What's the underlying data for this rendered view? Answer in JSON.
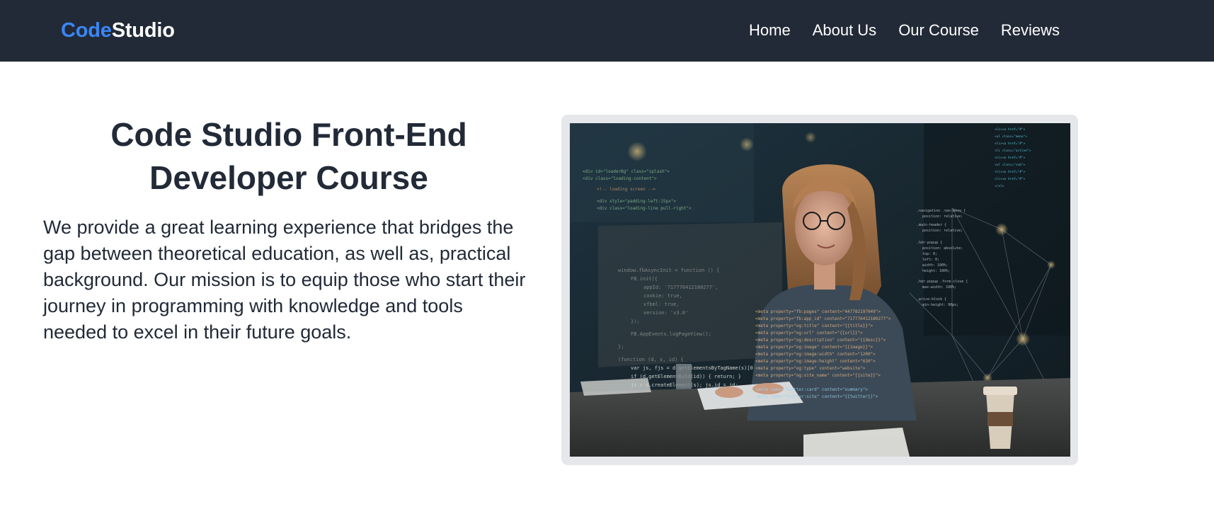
{
  "brand": {
    "part1": "Code",
    "part2": "Studio",
    "accent_color": "#3a86f5"
  },
  "nav": {
    "items": [
      {
        "label": "Home"
      },
      {
        "label": "About Us"
      },
      {
        "label": "Our Course"
      },
      {
        "label": "Reviews"
      }
    ]
  },
  "hero": {
    "title_line1": "Code Studio Front-End",
    "title_line2": "Developer Course",
    "description": "We provide a great learning experience that bridges the gap between theoretical education, as well as, practical background. Our mission is to equip those who start their journey in programming with knowledge and tools needed to excel in their future goals.",
    "image_subject": "woman-coding-at-computer-photo"
  },
  "colors": {
    "navbar_bg": "#222a37",
    "text_dark": "#222a37",
    "card_border": "#e6e7ea"
  }
}
